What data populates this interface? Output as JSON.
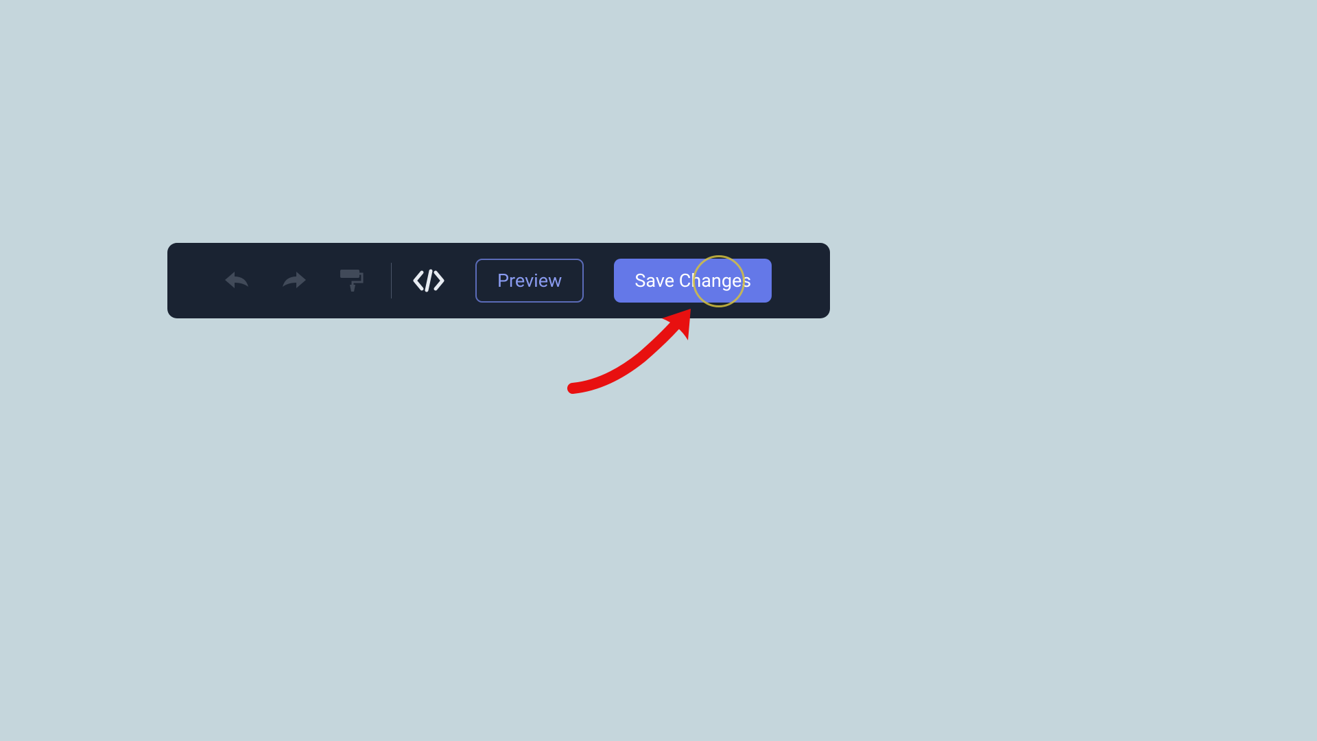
{
  "toolbar": {
    "preview_label": "Preview",
    "save_label": "Save Changes",
    "icons": {
      "undo": "undo-icon",
      "redo": "redo-icon",
      "paint": "paint-format-icon",
      "code": "code-icon"
    }
  },
  "annotation": {
    "highlight_target": "save-changes-button",
    "arrow_color": "#e81010",
    "circle_color": "#d4c040"
  },
  "colors": {
    "background": "#c5d6dc",
    "toolbar_bg": "#1a2332",
    "accent": "#6478e8",
    "outline_btn_border": "#5b6bb8",
    "outline_btn_text": "#8a9bf0",
    "icon_muted": "#7a8599",
    "icon_active": "#e8ecf2"
  }
}
